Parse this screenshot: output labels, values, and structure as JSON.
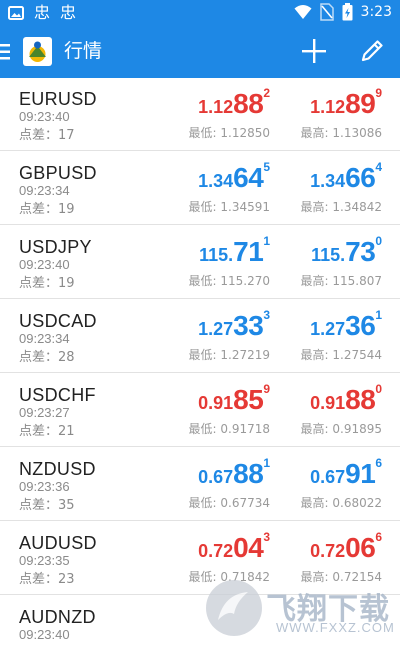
{
  "status": {
    "time": "3:23",
    "left_glyphs": [
      "忠",
      "忠"
    ]
  },
  "appbar": {
    "title": "行情"
  },
  "quotes": [
    {
      "symbol": "EURUSD",
      "time": "09:23:40",
      "spread_label": "点差：",
      "spread": "17",
      "bid": {
        "pre": "1.12",
        "big": "88",
        "sup": "2",
        "color": "red"
      },
      "ask": {
        "pre": "1.12",
        "big": "89",
        "sup": "9",
        "color": "red"
      },
      "low": "最低: 1.12850",
      "high": "最高: 1.13086"
    },
    {
      "symbol": "GBPUSD",
      "time": "09:23:34",
      "spread_label": "点差：",
      "spread": "19",
      "bid": {
        "pre": "1.34",
        "big": "64",
        "sup": "5",
        "color": "blue"
      },
      "ask": {
        "pre": "1.34",
        "big": "66",
        "sup": "4",
        "color": "blue"
      },
      "low": "最低: 1.34591",
      "high": "最高: 1.34842"
    },
    {
      "symbol": "USDJPY",
      "time": "09:23:40",
      "spread_label": "点差：",
      "spread": "19",
      "bid": {
        "pre": "115.",
        "big": "71",
        "sup": "1",
        "color": "blue"
      },
      "ask": {
        "pre": "115.",
        "big": "73",
        "sup": "0",
        "color": "blue"
      },
      "low": "最低: 115.270",
      "high": "最高: 115.807"
    },
    {
      "symbol": "USDCAD",
      "time": "09:23:34",
      "spread_label": "点差：",
      "spread": "28",
      "bid": {
        "pre": "1.27",
        "big": "33",
        "sup": "3",
        "color": "blue"
      },
      "ask": {
        "pre": "1.27",
        "big": "36",
        "sup": "1",
        "color": "blue"
      },
      "low": "最低: 1.27219",
      "high": "最高: 1.27544"
    },
    {
      "symbol": "USDCHF",
      "time": "09:23:27",
      "spread_label": "点差：",
      "spread": "21",
      "bid": {
        "pre": "0.91",
        "big": "85",
        "sup": "9",
        "color": "red"
      },
      "ask": {
        "pre": "0.91",
        "big": "88",
        "sup": "0",
        "color": "red"
      },
      "low": "最低: 0.91718",
      "high": "最高: 0.91895"
    },
    {
      "symbol": "NZDUSD",
      "time": "09:23:36",
      "spread_label": "点差：",
      "spread": "35",
      "bid": {
        "pre": "0.67",
        "big": "88",
        "sup": "1",
        "color": "blue"
      },
      "ask": {
        "pre": "0.67",
        "big": "91",
        "sup": "6",
        "color": "blue"
      },
      "low": "最低: 0.67734",
      "high": "最高: 0.68022"
    },
    {
      "symbol": "AUDUSD",
      "time": "09:23:35",
      "spread_label": "点差：",
      "spread": "23",
      "bid": {
        "pre": "0.72",
        "big": "04",
        "sup": "3",
        "color": "red"
      },
      "ask": {
        "pre": "0.72",
        "big": "06",
        "sup": "6",
        "color": "red"
      },
      "low": "最低: 0.71842",
      "high": "最高: 0.72154"
    },
    {
      "symbol": "AUDNZD",
      "time": "09:23:40",
      "spread_label": "",
      "spread": "",
      "bid": null,
      "ask": null,
      "low": "",
      "high": ""
    }
  ],
  "watermark": {
    "text": "飞翔下载",
    "url": "WWW.FXXZ.COM"
  },
  "colors": {
    "red": "#e53935",
    "blue": "#1e88e5",
    "bar": "#1e88e5"
  }
}
